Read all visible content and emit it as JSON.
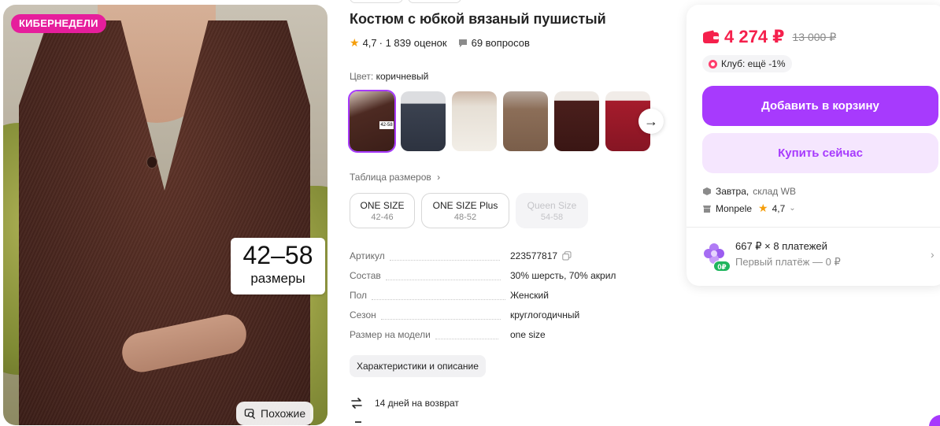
{
  "photo": {
    "promo_badge": "КИБЕРНЕДЕЛИ",
    "size_sticker_range": "42–58",
    "size_sticker_caption": "размеры",
    "similar_label": "Похожие"
  },
  "product": {
    "title": "Костюм с юбкой вязаный пушистый",
    "rating": "4,7",
    "reviews": "· 1 839 оценок",
    "questions": "69 вопросов",
    "color_label": "Цвет:",
    "color_value": "коричневый",
    "thumb_label": "42-58",
    "size_table_link": "Таблица размеров",
    "sizes": [
      {
        "name": "ONE SIZE",
        "range": "42-46",
        "available": true
      },
      {
        "name": "ONE SIZE Plus",
        "range": "48-52",
        "available": true
      },
      {
        "name": "Queen Size",
        "range": "54-58",
        "available": false
      }
    ],
    "specs": [
      {
        "key": "Артикул",
        "value": "223577817"
      },
      {
        "key": "Состав",
        "value": "30% шерсть, 70% акрил"
      },
      {
        "key": "Пол",
        "value": "Женский"
      },
      {
        "key": "Сезон",
        "value": "круглогодичный"
      },
      {
        "key": "Размер на модели",
        "value": "one size"
      }
    ],
    "characteristics_button": "Характеристики и описание",
    "return_policy": "14 дней на возврат"
  },
  "buy_card": {
    "price": "4 274 ₽",
    "old_price": "13 000 ₽",
    "club_text": "Клуб: ещё -1%",
    "add_to_cart": "Добавить в корзину",
    "buy_now": "Купить сейчас",
    "delivery_day": "Завтра,",
    "delivery_warehouse": "склад WB",
    "seller_name": "Monpele",
    "seller_rating": "4,7",
    "installment_main": "667 ₽ × 8 платежей",
    "installment_sub": "Первый платёж — 0 ₽",
    "installment_badge": "0₽"
  },
  "colors": {
    "accent": "#a73afd",
    "accent_light": "#f5e6fe",
    "price": "#f5204c",
    "promo": "#e61e9c",
    "star": "#f59e0b"
  }
}
